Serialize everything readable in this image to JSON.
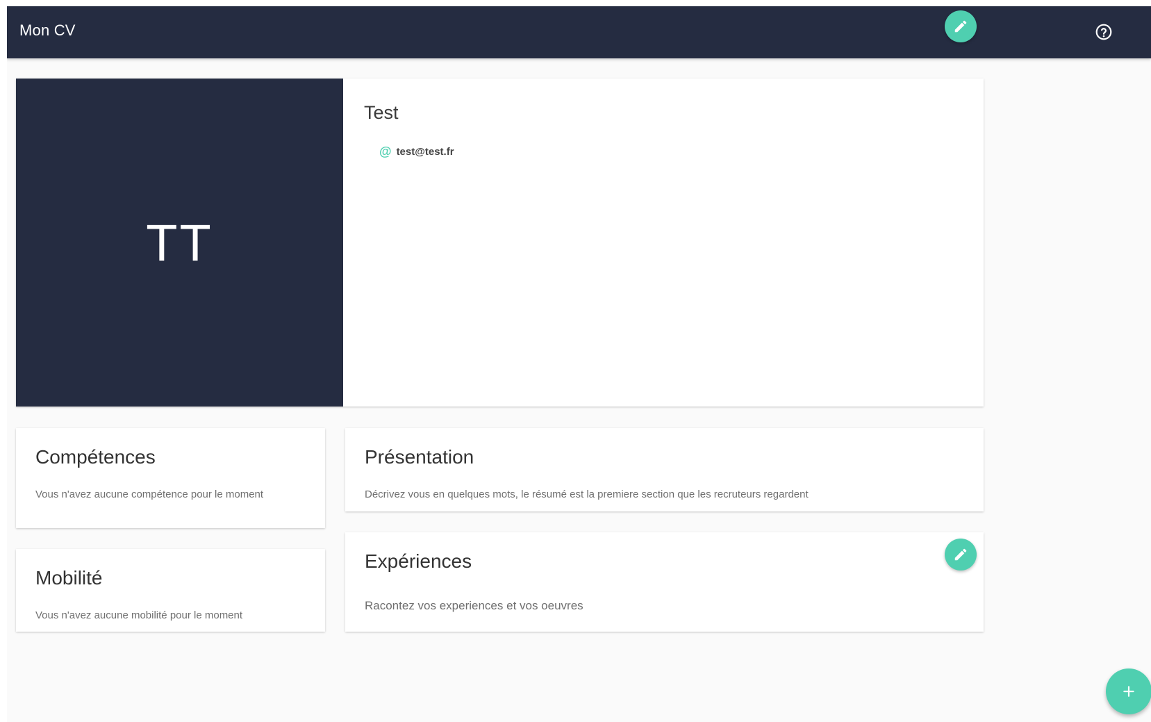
{
  "header": {
    "title": "Mon CV",
    "help_icon": "help-circle-icon"
  },
  "profile": {
    "initials": "TT",
    "name": "Test",
    "email": "test@test.fr",
    "email_icon": "at-icon",
    "edit_icon": "pencil-icon"
  },
  "sections": {
    "competences": {
      "title": "Compétences",
      "text": "Vous n'avez aucune compétence pour le moment"
    },
    "mobilite": {
      "title": "Mobilité",
      "text": "Vous n'avez aucune mobilité pour le moment"
    },
    "presentation": {
      "title": "Présentation",
      "text": "Décrivez vous en quelques mots, le résumé est la premiere section que les recruteurs regardent"
    },
    "experiences": {
      "title": "Expériences",
      "text": "Racontez vos experiences et vos oeuvres",
      "edit_icon": "pencil-icon"
    }
  },
  "add_button": {
    "icon": "plus-icon"
  },
  "colors": {
    "navy": "#252c41",
    "accent": "#4fcfb0",
    "background": "#fafafa"
  }
}
